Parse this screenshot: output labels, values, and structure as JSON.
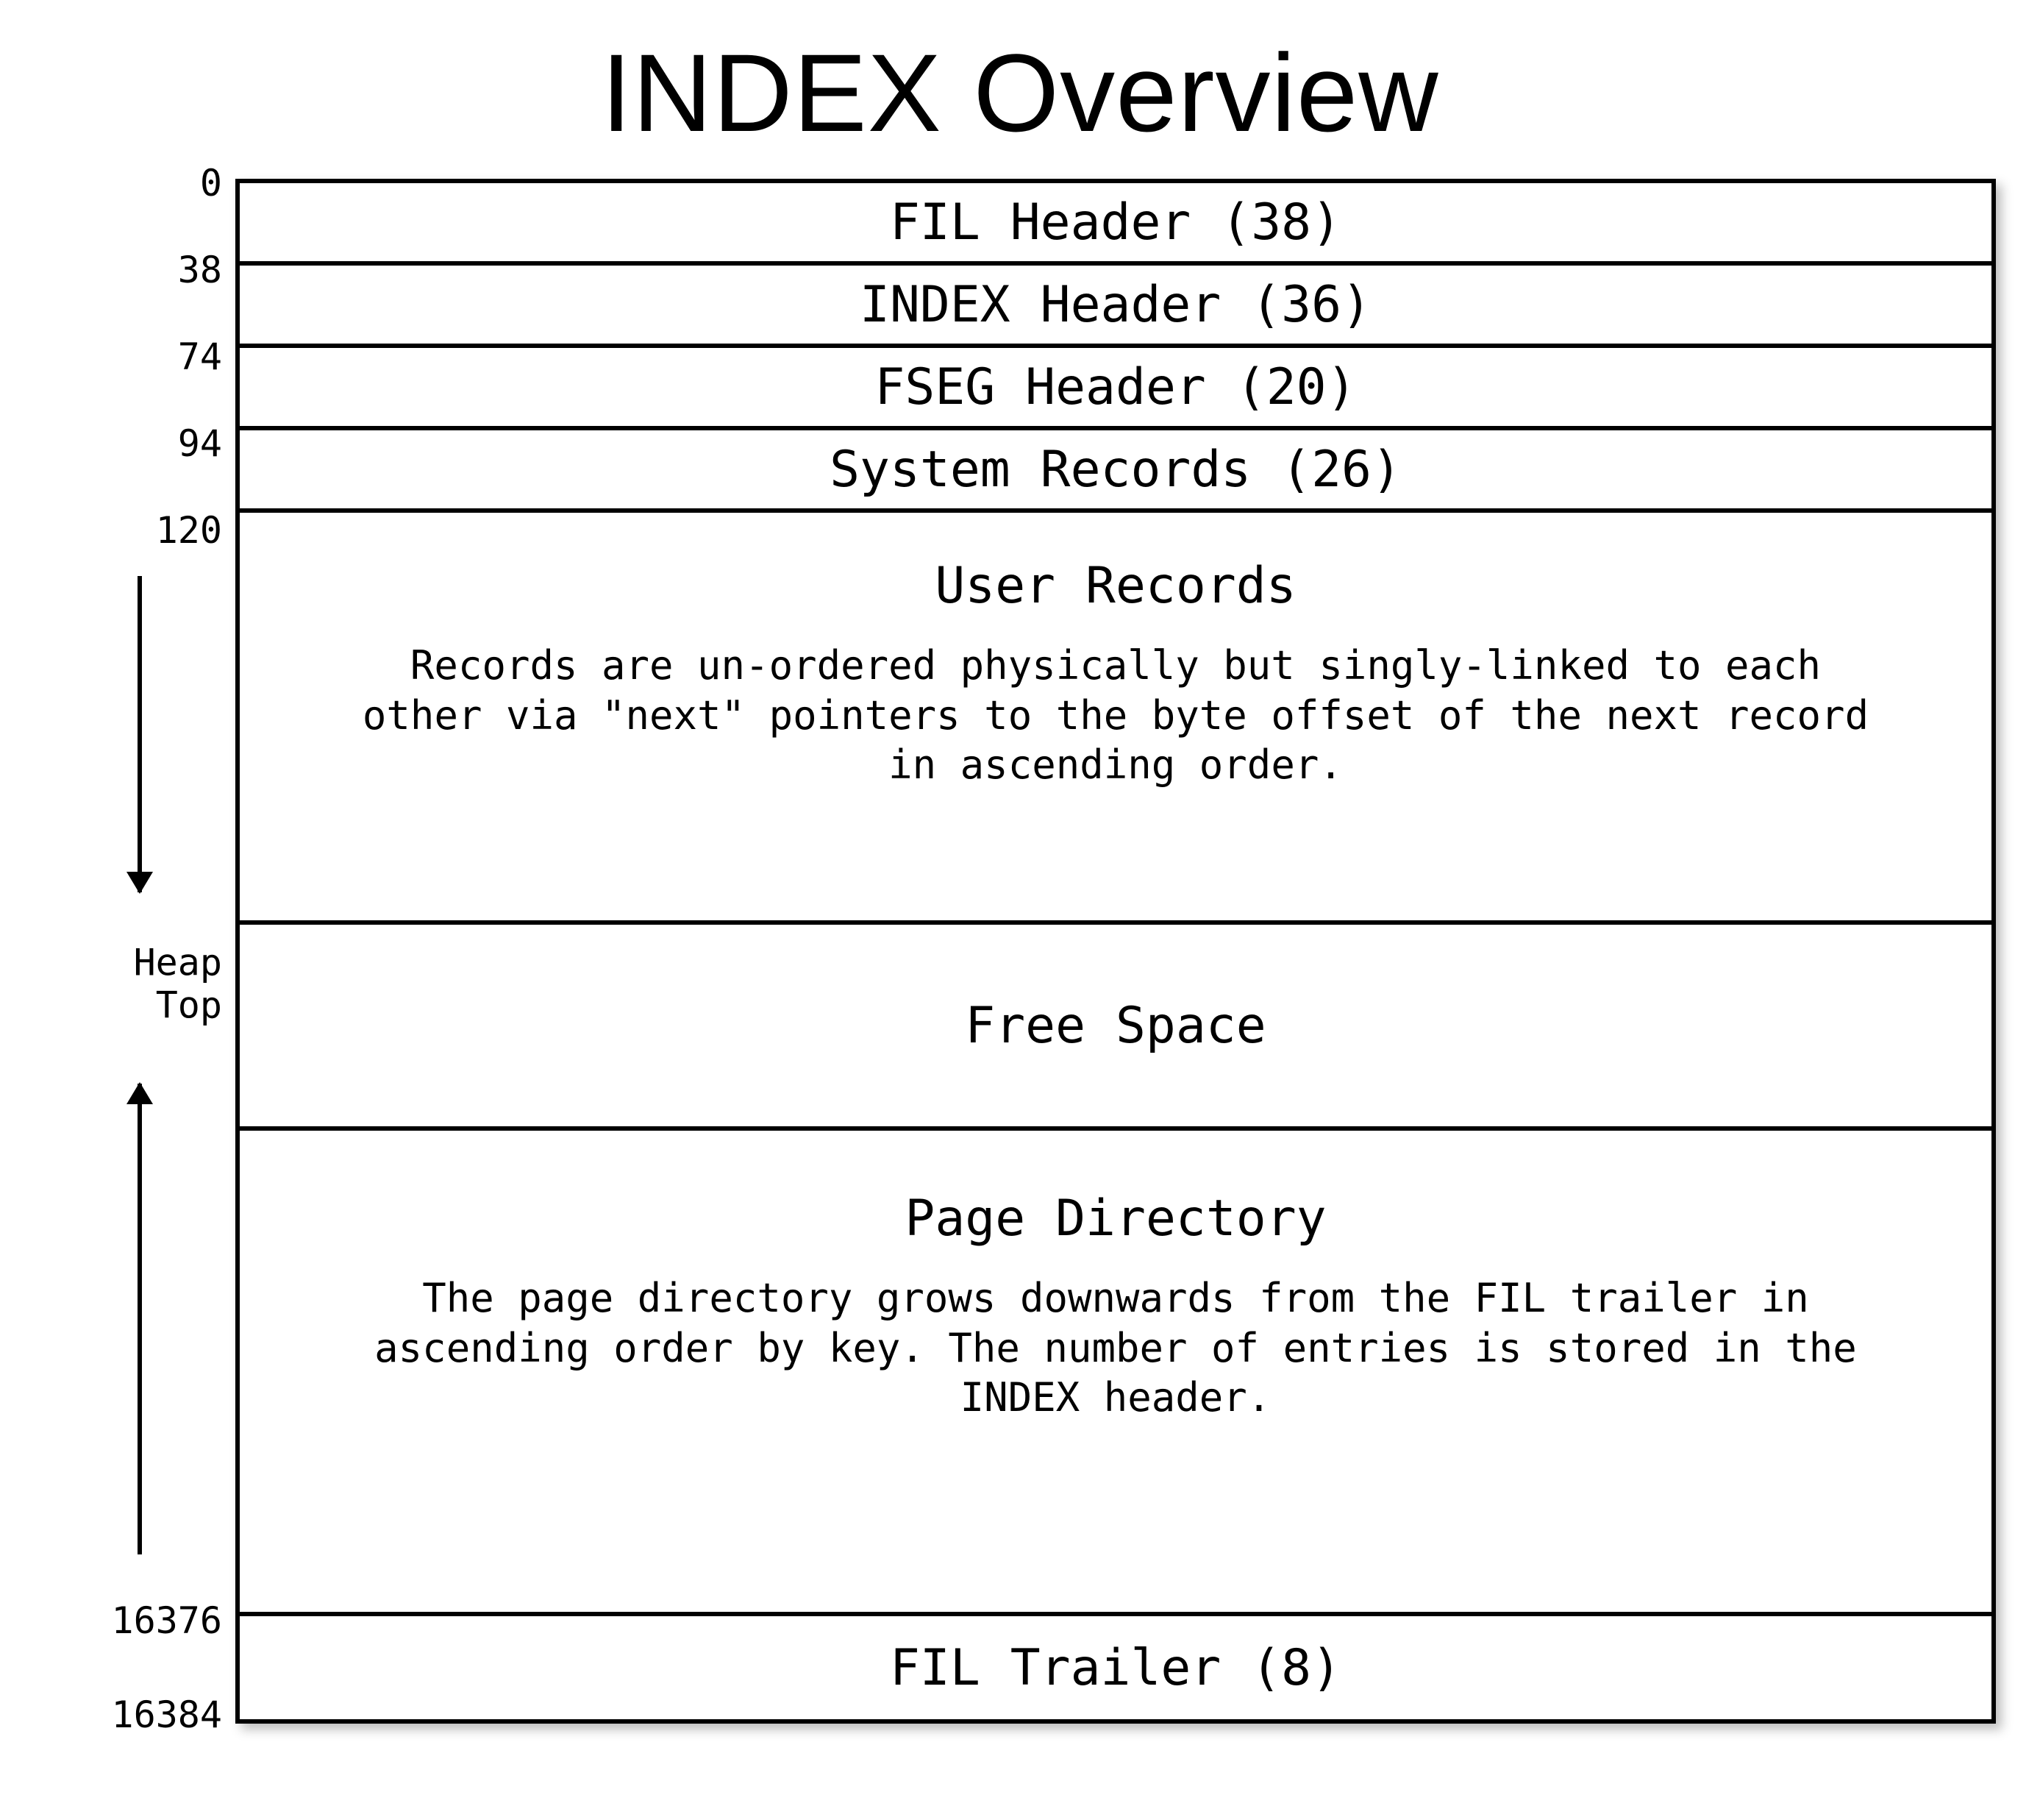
{
  "title": "INDEX Overview",
  "offsets": {
    "o0": "0",
    "o38": "38",
    "o74": "74",
    "o94": "94",
    "o120": "120",
    "heap_top_l1": "Heap",
    "heap_top_l2": "Top",
    "o16376": "16376",
    "o16384": "16384"
  },
  "rows": {
    "fil_header": "FIL Header (38)",
    "index_header": "INDEX Header (36)",
    "fseg_header": "FSEG Header (20)",
    "system_records": "System Records (26)",
    "user_records_title": "User Records",
    "user_records_desc": "Records are un-ordered physically but singly-linked to each other via \"next\" pointers to the byte offset of the next record in ascending order.",
    "free_space": "Free Space",
    "page_directory_title": "Page Directory",
    "page_directory_desc": "The page directory grows downwards from the FIL trailer in ascending order by key. The number of entries is stored in the INDEX header.",
    "fil_trailer": "FIL Trailer (8)"
  },
  "chart_data": {
    "type": "table",
    "title": "INDEX Overview",
    "total_bytes": 16384,
    "segments": [
      {
        "name": "FIL Header",
        "start": 0,
        "end": 38,
        "size": 38
      },
      {
        "name": "INDEX Header",
        "start": 38,
        "end": 74,
        "size": 36
      },
      {
        "name": "FSEG Header",
        "start": 74,
        "end": 94,
        "size": 20
      },
      {
        "name": "System Records",
        "start": 94,
        "end": 120,
        "size": 26
      },
      {
        "name": "User Records",
        "start": 120,
        "end": "Heap Top",
        "size": "variable",
        "grows": "down",
        "note": "Records are un-ordered physically but singly-linked to each other via \"next\" pointers to the byte offset of the next record in ascending order."
      },
      {
        "name": "Free Space",
        "start": "Heap Top",
        "end": "Page Directory start",
        "size": "variable"
      },
      {
        "name": "Page Directory",
        "start": "variable",
        "end": 16376,
        "size": "variable",
        "grows": "up",
        "note": "The page directory grows downwards from the FIL trailer in ascending order by key. The number of entries is stored in the INDEX header."
      },
      {
        "name": "FIL Trailer",
        "start": 16376,
        "end": 16384,
        "size": 8
      }
    ]
  }
}
